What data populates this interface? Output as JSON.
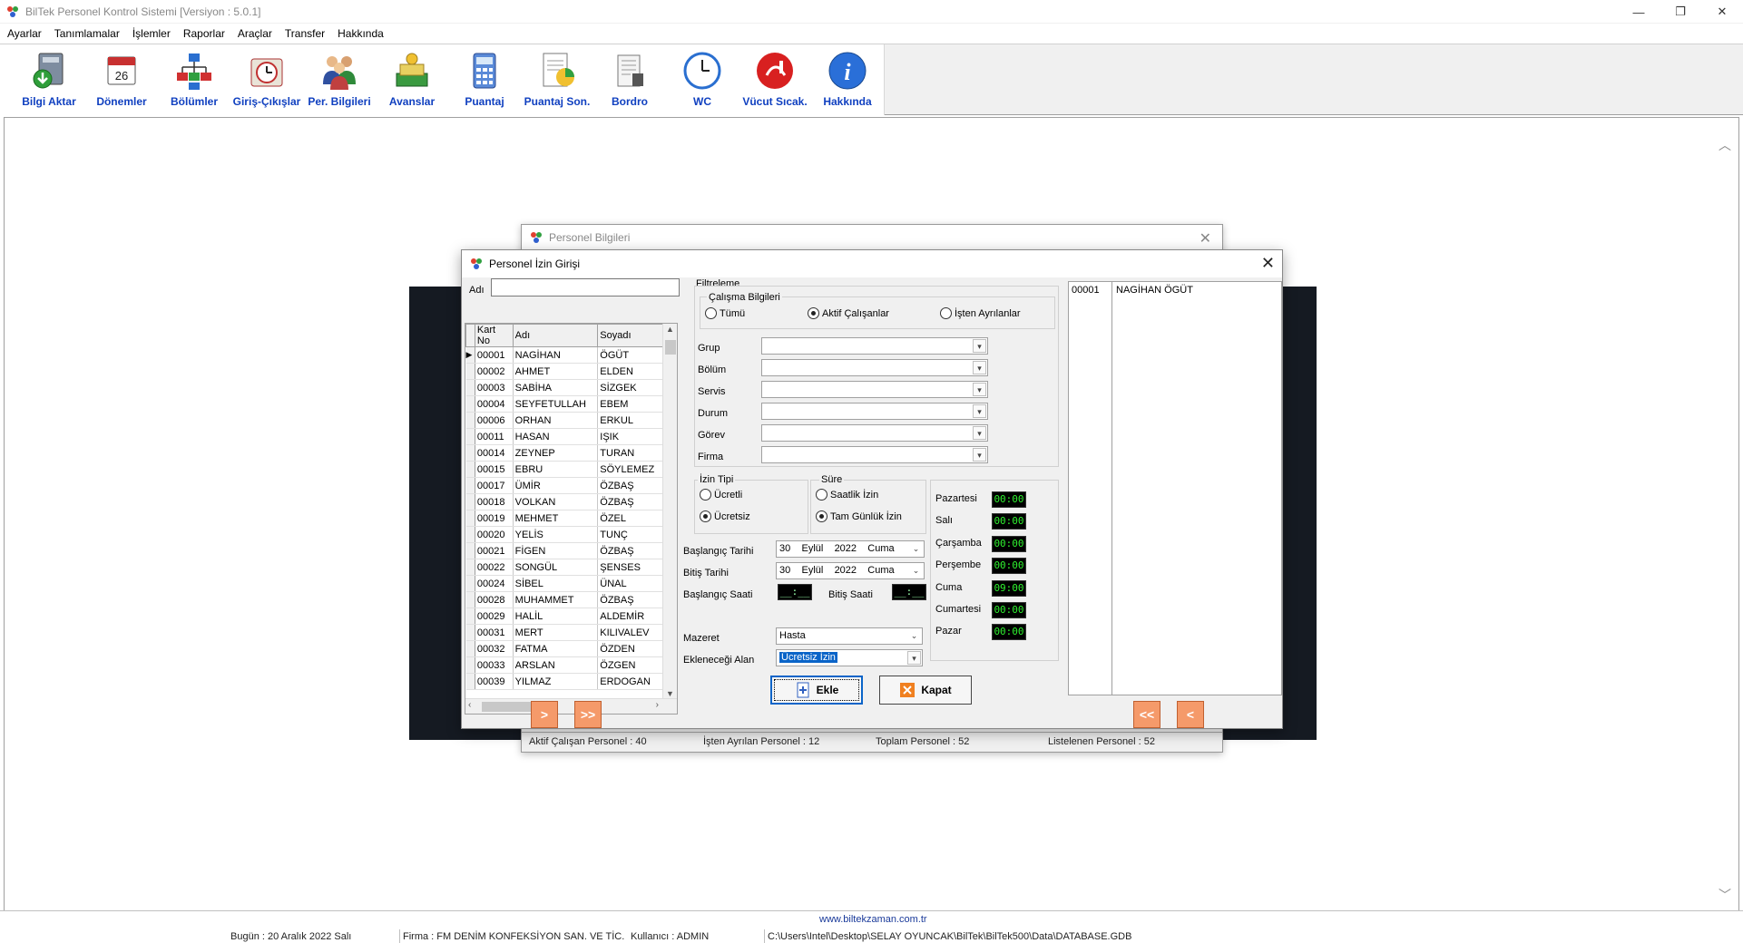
{
  "app": {
    "title": "BilTek Personel Kontrol Sistemi [Versiyon : 5.0.1]",
    "win_controls": [
      "—",
      "❐",
      "✕"
    ]
  },
  "menu": [
    "Ayarlar",
    "Tanımlamalar",
    "İşlemler",
    "Raporlar",
    "Araçlar",
    "Transfer",
    "Hakkında"
  ],
  "toolbar": [
    {
      "label": "Bilgi Aktar",
      "icon": "data-transfer-icon"
    },
    {
      "label": "Dönemler",
      "icon": "calendar-icon"
    },
    {
      "label": "Bölümler",
      "icon": "org-chart-icon"
    },
    {
      "label": "Giriş-Çıkışlar",
      "icon": "clock-icon"
    },
    {
      "label": "Per. Bilgileri",
      "icon": "people-icon"
    },
    {
      "label": "Avanslar",
      "icon": "money-icon"
    },
    {
      "label": "Puantaj",
      "icon": "calculator-icon"
    },
    {
      "label": "Puantaj Son.",
      "icon": "report-chart-icon"
    },
    {
      "label": "Bordro",
      "icon": "payroll-icon"
    },
    {
      "label": "WC",
      "icon": "wall-clock-icon"
    },
    {
      "label": "Vücut Sıcak.",
      "icon": "thermometer-icon"
    },
    {
      "label": "Hakkında",
      "icon": "info-icon"
    }
  ],
  "back_dialog": {
    "title": "Personel Bilgileri",
    "status": [
      "Aktif Çalışan Personel : 40",
      "İşten Ayrılan Personel : 12",
      "Toplam Personel : 52",
      "Listelenen Personel : 52"
    ]
  },
  "dialog": {
    "title": "Personel İzin Girişi",
    "name_label": "Adı",
    "name_value": "",
    "columns": [
      "Kart No",
      "Adı",
      "Soyadı"
    ],
    "rows": [
      [
        "00001",
        "NAGİHAN",
        "ÖGÜT"
      ],
      [
        "00002",
        "AHMET",
        "ELDEN"
      ],
      [
        "00003",
        "SABİHA",
        "SİZGEK"
      ],
      [
        "00004",
        "SEYFETULLAH",
        "EBEM"
      ],
      [
        "00006",
        "ORHAN",
        "ERKUL"
      ],
      [
        "00011",
        "HASAN",
        "IŞIK"
      ],
      [
        "00014",
        "ZEYNEP",
        "TURAN"
      ],
      [
        "00015",
        "EBRU",
        "SÖYLEMEZ"
      ],
      [
        "00017",
        "ÜMİR",
        "ÖZBAŞ"
      ],
      [
        "00018",
        "VOLKAN",
        "ÖZBAŞ"
      ],
      [
        "00019",
        "MEHMET",
        "ÖZEL"
      ],
      [
        "00020",
        "YELİS",
        "TUNÇ"
      ],
      [
        "00021",
        "FİGEN",
        "ÖZBAŞ"
      ],
      [
        "00022",
        "SONGÜL",
        "ŞENSES"
      ],
      [
        "00024",
        "SİBEL",
        "ÜNAL"
      ],
      [
        "00028",
        "MUHAMMET",
        "ÖZBAŞ"
      ],
      [
        "00029",
        "HALİL",
        "ALDEMİR"
      ],
      [
        "00031",
        "MERT",
        "KILIVALEV"
      ],
      [
        "00032",
        "FATMA",
        "ÖZDEN"
      ],
      [
        "00033",
        "ARSLAN",
        "ÖZGEN"
      ],
      [
        "00039",
        "YILMAZ",
        "ERDOGAN"
      ]
    ],
    "filter": {
      "title": "Filtreleme",
      "work_info_title": "Çalışma Bilgileri",
      "options": [
        "Tümü",
        "Aktif Çalışanlar",
        "İşten Ayrılanlar"
      ],
      "selected": "Aktif Çalışanlar",
      "fields": [
        "Grup",
        "Bölüm",
        "Servis",
        "Durum",
        "Görev",
        "Firma"
      ]
    },
    "leave_type": {
      "title": "İzin Tipi",
      "options": [
        "Ücretli",
        "Ücretsiz"
      ],
      "selected": "Ücretsiz"
    },
    "duration": {
      "title": "Süre",
      "options": [
        "Saatlik İzin",
        "Tam Günlük İzin"
      ],
      "selected": "Tam Günlük İzin"
    },
    "start_date_label": "Başlangıç Tarihi",
    "start_date": {
      "day": "30",
      "month": "Eylül",
      "year": "2022",
      "weekday": "Cuma"
    },
    "end_date_label": "Bitiş Tarihi",
    "end_date": {
      "day": "30",
      "month": "Eylül",
      "year": "2022",
      "weekday": "Cuma"
    },
    "start_time_label": "Başlangıç Saati",
    "end_time_label": "Bitiş Saati",
    "time_blank": "__:__",
    "excuse_label": "Mazeret",
    "excuse_value": "Hasta",
    "field_label": "Ekleneceği Alan",
    "field_value": "Ücretsiz İzin",
    "days": [
      {
        "day": "Pazartesi",
        "time": "00:00"
      },
      {
        "day": "Salı",
        "time": "00:00"
      },
      {
        "day": "Çarşamba",
        "time": "00:00"
      },
      {
        "day": "Perşembe",
        "time": "00:00"
      },
      {
        "day": "Cuma",
        "time": "09:00"
      },
      {
        "day": "Cumartesi",
        "time": "00:00"
      },
      {
        "day": "Pazar",
        "time": "00:00"
      }
    ],
    "add_button": "Ekle",
    "close_button": "Kapat",
    "nav": {
      "next": ">",
      "all_next": ">>",
      "all_prev": "<<",
      "prev": "<"
    },
    "selected_list": [
      [
        "00001",
        "NAGİHAN ÖGÜT"
      ]
    ]
  },
  "status": {
    "site": "www.biltekzaman.com.tr",
    "today": "Bugün : 20 Aralık 2022 Salı",
    "firm": "Firma : FM DENİM KONFEKSİYON SAN. VE TİC.",
    "user": "Kullanıcı : ADMIN",
    "path": "C:\\Users\\Intel\\Desktop\\SELAY OYUNCAK\\BilTek\\BilTek500\\Data\\DATABASE.GDB"
  }
}
